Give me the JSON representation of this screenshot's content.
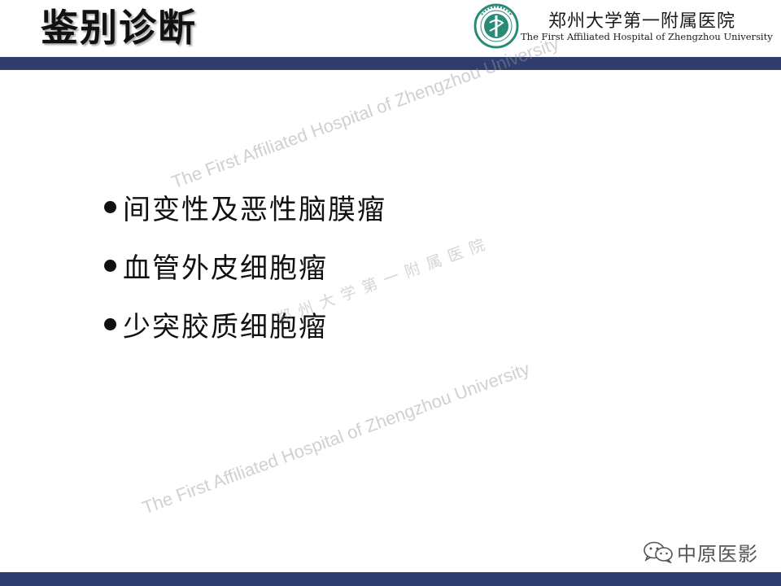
{
  "slide": {
    "title": "鉴别诊断",
    "bullets": [
      "间变性及恶性脑膜瘤",
      "血管外皮细胞瘤",
      "少突胶质细胞瘤"
    ]
  },
  "header": {
    "hospital_name_cn": "郑州大学第一附属医院",
    "hospital_name_en": "The First Affiliated Hospital of Zhengzhou University",
    "logo_icon": "hospital-emblem-icon"
  },
  "watermarks": {
    "en_top": "The First  Affiliated Hospital of Zhengzhou University",
    "cn_middle": "郑州大学第一附属医院",
    "en_bottom": "The First  Affiliated Hospital of Zhengzhou University"
  },
  "branding": {
    "icon": "wechat-icon",
    "text": "中原医影"
  },
  "colors": {
    "bar": "#2f3d6e",
    "logo_green": "#2a8a78",
    "text": "#111111"
  }
}
